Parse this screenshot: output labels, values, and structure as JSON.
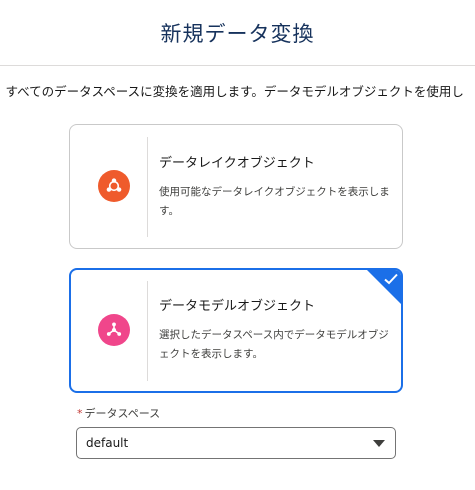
{
  "modal": {
    "title": "新規データ変換",
    "description": "、すべてのデータスペースに変換を適用します。データモデルオブジェクトを使用し"
  },
  "cards": [
    {
      "title": "データレイクオブジェクト",
      "description": "使用可能なデータレイクオブジェクトを表示します。",
      "icon": "data-lake-object-icon",
      "icon_color": "#ef5b2c",
      "selected": false
    },
    {
      "title": "データモデルオブジェクト",
      "description": "選択したデータスペース内でデータモデルオブジェクトを表示します。",
      "icon": "data-model-object-icon",
      "icon_color": "#f0468b",
      "selected": true
    }
  ],
  "data_space": {
    "required_marker": "*",
    "label": "データスペース",
    "value": "default"
  },
  "colors": {
    "selected_border": "#1b6fe8",
    "title": "#16325c",
    "required": "#c23934"
  }
}
